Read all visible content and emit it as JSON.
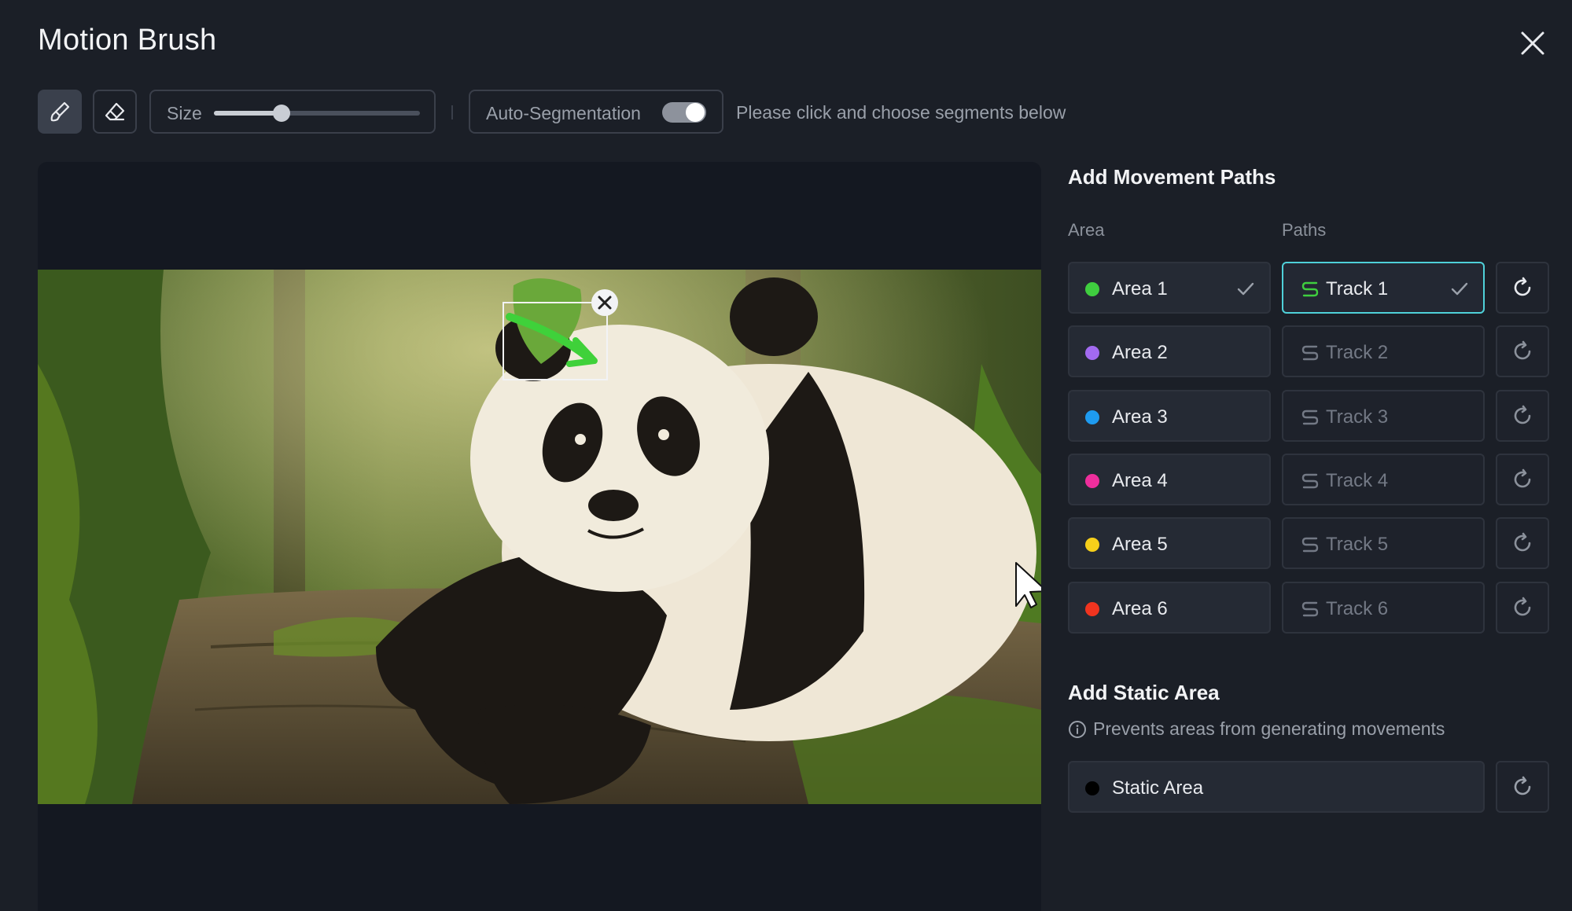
{
  "dialog": {
    "title": "Motion Brush"
  },
  "toolbar": {
    "size_label": "Size",
    "size_value_fraction": 0.33,
    "auto_segmentation_label": "Auto-Segmentation",
    "auto_segmentation_on": true,
    "hint": "Please click and choose segments below"
  },
  "icons": {
    "close": "close-icon",
    "brush": "brush-icon",
    "eraser": "eraser-icon",
    "path": "path-icon",
    "check": "check-icon",
    "reset": "reset-icon",
    "info": "info-icon"
  },
  "sidebar": {
    "movement_title": "Add Movement Paths",
    "area_col": "Area",
    "paths_col": "Paths",
    "rows": [
      {
        "area": "Area 1",
        "color": "#3fce3f",
        "track": "Track 1",
        "active": true
      },
      {
        "area": "Area 2",
        "color": "#a26af0",
        "track": "Track 2",
        "active": false
      },
      {
        "area": "Area 3",
        "color": "#1e9bf0",
        "track": "Track 3",
        "active": false
      },
      {
        "area": "Area 4",
        "color": "#ee2e9c",
        "track": "Track 4",
        "active": false
      },
      {
        "area": "Area 5",
        "color": "#f6cf1a",
        "track": "Track 5",
        "active": false
      },
      {
        "area": "Area 6",
        "color": "#f0341f",
        "track": "Track 6",
        "active": false
      }
    ],
    "static_title": "Add Static Area",
    "static_info": "Prevents areas from generating movements",
    "static_label": "Static Area",
    "static_color": "#000000"
  },
  "colors": {
    "accent": "#4fd1d9",
    "track_active_icon": "#3fce3f"
  }
}
